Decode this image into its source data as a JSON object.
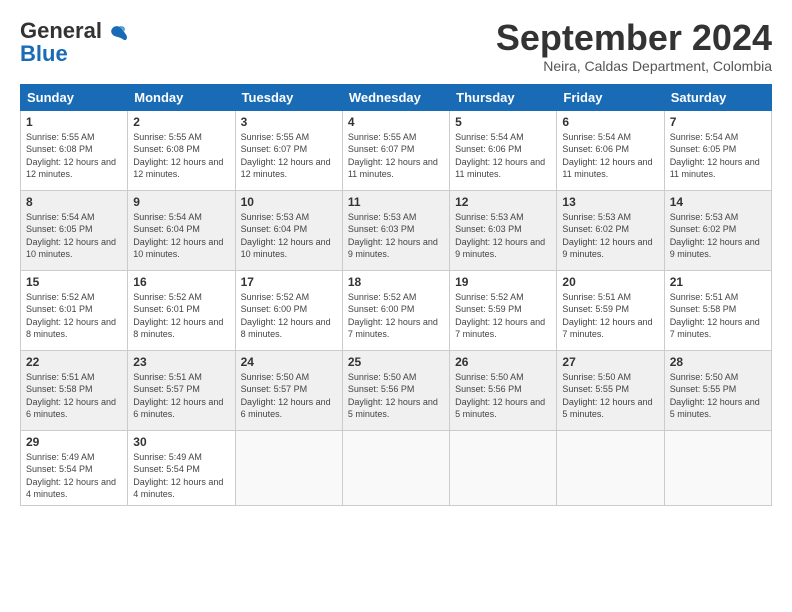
{
  "logo": {
    "line1": "General",
    "line2": "Blue"
  },
  "header": {
    "month": "September 2024",
    "location": "Neira, Caldas Department, Colombia"
  },
  "days": [
    "Sunday",
    "Monday",
    "Tuesday",
    "Wednesday",
    "Thursday",
    "Friday",
    "Saturday"
  ],
  "weeks": [
    [
      {
        "num": "1",
        "rise": "5:55 AM",
        "set": "6:08 PM",
        "daylight": "12 hours and 12 minutes."
      },
      {
        "num": "2",
        "rise": "5:55 AM",
        "set": "6:08 PM",
        "daylight": "12 hours and 12 minutes."
      },
      {
        "num": "3",
        "rise": "5:55 AM",
        "set": "6:07 PM",
        "daylight": "12 hours and 12 minutes."
      },
      {
        "num": "4",
        "rise": "5:55 AM",
        "set": "6:07 PM",
        "daylight": "12 hours and 11 minutes."
      },
      {
        "num": "5",
        "rise": "5:54 AM",
        "set": "6:06 PM",
        "daylight": "12 hours and 11 minutes."
      },
      {
        "num": "6",
        "rise": "5:54 AM",
        "set": "6:06 PM",
        "daylight": "12 hours and 11 minutes."
      },
      {
        "num": "7",
        "rise": "5:54 AM",
        "set": "6:05 PM",
        "daylight": "12 hours and 11 minutes."
      }
    ],
    [
      {
        "num": "8",
        "rise": "5:54 AM",
        "set": "6:05 PM",
        "daylight": "12 hours and 10 minutes."
      },
      {
        "num": "9",
        "rise": "5:54 AM",
        "set": "6:04 PM",
        "daylight": "12 hours and 10 minutes."
      },
      {
        "num": "10",
        "rise": "5:53 AM",
        "set": "6:04 PM",
        "daylight": "12 hours and 10 minutes."
      },
      {
        "num": "11",
        "rise": "5:53 AM",
        "set": "6:03 PM",
        "daylight": "12 hours and 9 minutes."
      },
      {
        "num": "12",
        "rise": "5:53 AM",
        "set": "6:03 PM",
        "daylight": "12 hours and 9 minutes."
      },
      {
        "num": "13",
        "rise": "5:53 AM",
        "set": "6:02 PM",
        "daylight": "12 hours and 9 minutes."
      },
      {
        "num": "14",
        "rise": "5:53 AM",
        "set": "6:02 PM",
        "daylight": "12 hours and 9 minutes."
      }
    ],
    [
      {
        "num": "15",
        "rise": "5:52 AM",
        "set": "6:01 PM",
        "daylight": "12 hours and 8 minutes."
      },
      {
        "num": "16",
        "rise": "5:52 AM",
        "set": "6:01 PM",
        "daylight": "12 hours and 8 minutes."
      },
      {
        "num": "17",
        "rise": "5:52 AM",
        "set": "6:00 PM",
        "daylight": "12 hours and 8 minutes."
      },
      {
        "num": "18",
        "rise": "5:52 AM",
        "set": "6:00 PM",
        "daylight": "12 hours and 7 minutes."
      },
      {
        "num": "19",
        "rise": "5:52 AM",
        "set": "5:59 PM",
        "daylight": "12 hours and 7 minutes."
      },
      {
        "num": "20",
        "rise": "5:51 AM",
        "set": "5:59 PM",
        "daylight": "12 hours and 7 minutes."
      },
      {
        "num": "21",
        "rise": "5:51 AM",
        "set": "5:58 PM",
        "daylight": "12 hours and 7 minutes."
      }
    ],
    [
      {
        "num": "22",
        "rise": "5:51 AM",
        "set": "5:58 PM",
        "daylight": "12 hours and 6 minutes."
      },
      {
        "num": "23",
        "rise": "5:51 AM",
        "set": "5:57 PM",
        "daylight": "12 hours and 6 minutes."
      },
      {
        "num": "24",
        "rise": "5:50 AM",
        "set": "5:57 PM",
        "daylight": "12 hours and 6 minutes."
      },
      {
        "num": "25",
        "rise": "5:50 AM",
        "set": "5:56 PM",
        "daylight": "12 hours and 5 minutes."
      },
      {
        "num": "26",
        "rise": "5:50 AM",
        "set": "5:56 PM",
        "daylight": "12 hours and 5 minutes."
      },
      {
        "num": "27",
        "rise": "5:50 AM",
        "set": "5:55 PM",
        "daylight": "12 hours and 5 minutes."
      },
      {
        "num": "28",
        "rise": "5:50 AM",
        "set": "5:55 PM",
        "daylight": "12 hours and 5 minutes."
      }
    ],
    [
      {
        "num": "29",
        "rise": "5:49 AM",
        "set": "5:54 PM",
        "daylight": "12 hours and 4 minutes."
      },
      {
        "num": "30",
        "rise": "5:49 AM",
        "set": "5:54 PM",
        "daylight": "12 hours and 4 minutes."
      },
      null,
      null,
      null,
      null,
      null
    ]
  ]
}
